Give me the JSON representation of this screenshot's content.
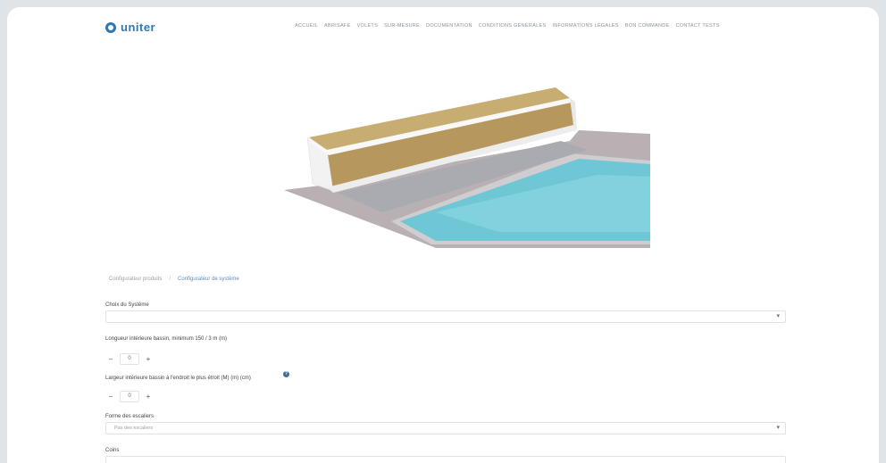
{
  "header": {
    "logo_text": "uniter",
    "nav": [
      "Accueil",
      "Abrisafe",
      "Volets",
      "Sur-mesure",
      "Documentation",
      "Conditions Générales",
      "Informations légales",
      "Bon commande",
      "Contact Tests"
    ]
  },
  "breadcrumb": {
    "first": "Configurateur produits",
    "separator": "/",
    "current": "Configurateur de système"
  },
  "form": {
    "system_label": "Choix du Système",
    "system_value": "",
    "length_label": "Longueur intérieure bassin, minimum 150 / 3 m (m)",
    "length_value": "0",
    "width_label": "Largeur intérieure bassin à l'endroit le plus étroit (M) (m) (cm)",
    "width_value": "0",
    "stair_label": "Forme des escaliers",
    "stair_value": "Pas des escaliers",
    "next_label": "Coins"
  },
  "icons": {
    "minus": "−",
    "plus": "+",
    "caret": "▾",
    "help": "?"
  }
}
